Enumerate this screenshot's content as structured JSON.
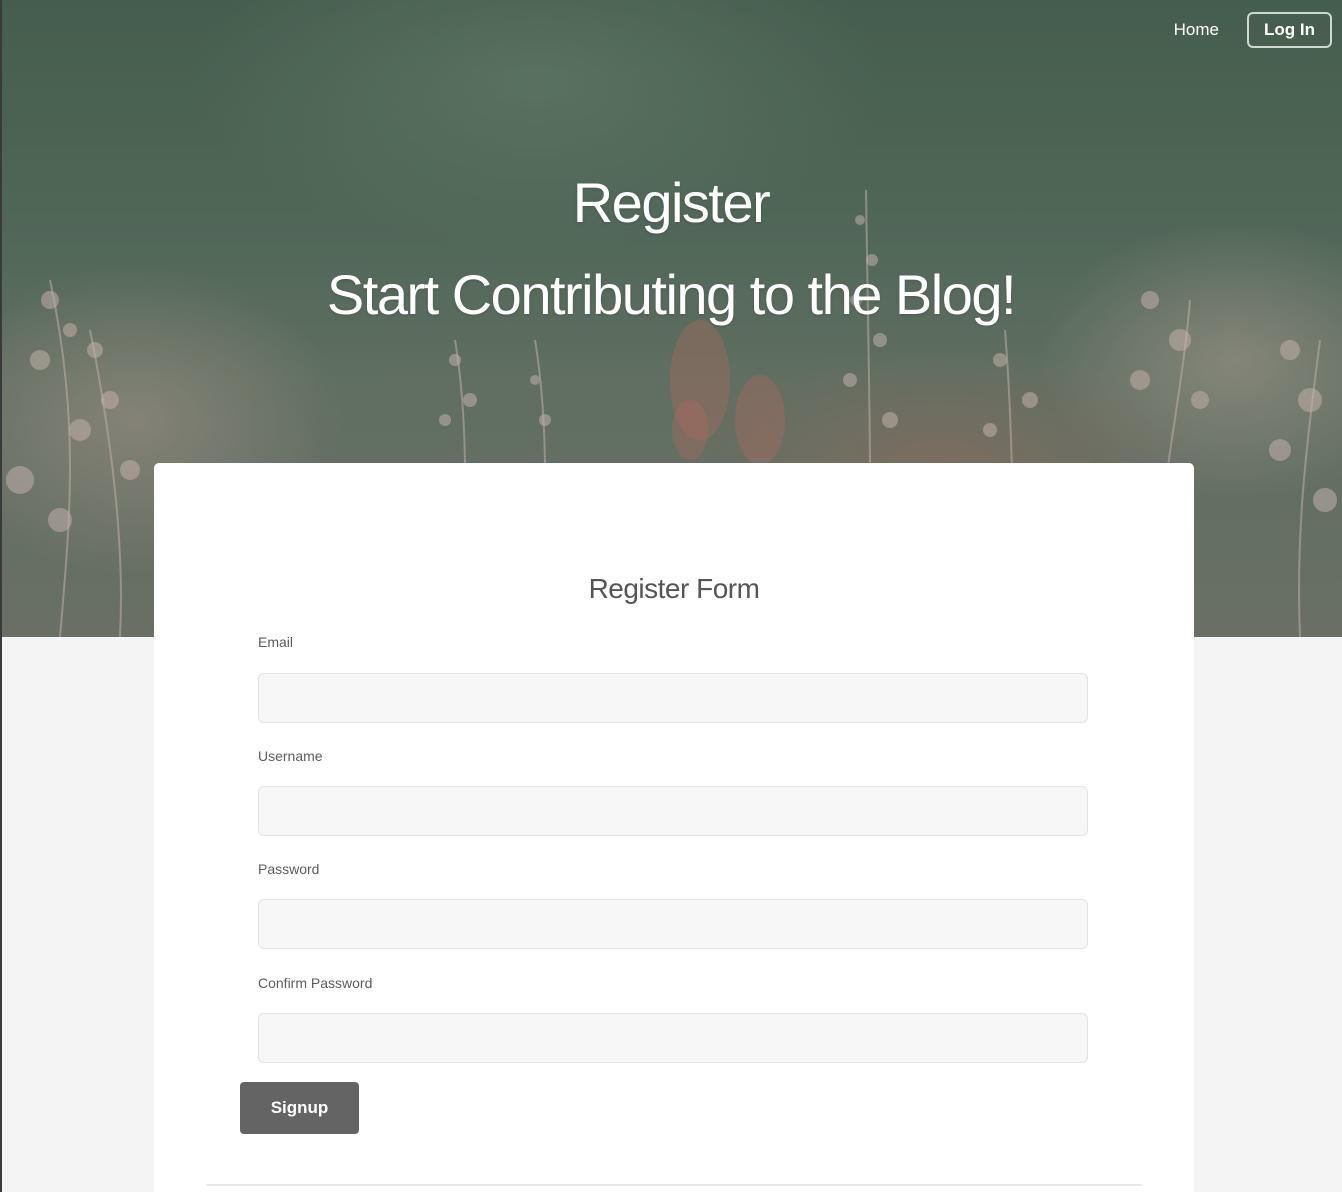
{
  "nav": {
    "home_label": "Home",
    "login_label": "Log In"
  },
  "hero": {
    "title": "Register",
    "subtitle": "Start Contributing to the Blog!"
  },
  "form": {
    "title": "Register Form",
    "fields": [
      {
        "label": "Email",
        "value": "",
        "type": "email"
      },
      {
        "label": "Username",
        "value": "",
        "type": "text"
      },
      {
        "label": "Password",
        "value": "",
        "type": "password"
      },
      {
        "label": "Confirm Password",
        "value": "",
        "type": "password"
      }
    ],
    "submit_label": "Signup"
  },
  "colors": {
    "button_bg": "#646464",
    "input_bg": "#f7f7f7",
    "page_bg": "#f4f4f4"
  }
}
